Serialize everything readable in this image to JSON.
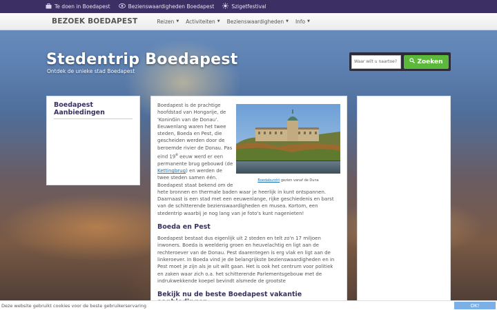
{
  "topbar": {
    "links": [
      {
        "label": "Te doen in Boedapest",
        "icon": "briefcase-icon"
      },
      {
        "label": "Bezienswaardigheden Boedapest",
        "icon": "eye-icon"
      },
      {
        "label": "Szigetfestival",
        "icon": "sun-icon"
      }
    ]
  },
  "navbar": {
    "brand": "BEZOEK BOEDAPEST",
    "menu": [
      "Reizen",
      "Activiteiten",
      "Bezienswaardigheden",
      "Info"
    ]
  },
  "hero": {
    "title": "Stedentrip Boedapest",
    "subtitle": "Ontdek de unieke stad Boedapest"
  },
  "search": {
    "placeholder": "Waar wilt u naartoe?",
    "button_label": "Zoeken"
  },
  "sidebar": {
    "heading": "Boedapest Aanbiedingen"
  },
  "article": {
    "image_caption_link": "Boedaburcht",
    "image_caption_rest": " gezien vanaf de Duna",
    "intro_1": "Boedapest is de prachtige hoofdstad van Hongarije, de 'KoninGin van de Donau'. Eeuwenlang waren het twee steden, Boeda en Pest, die gescheiden werden door de beroemde rivier de Donau. Pas eind 19",
    "intro_sup": "e",
    "intro_2": " eeuw werd er een permanente brug gebouwd (de ",
    "intro_link": "Kettingbrug",
    "intro_3": ") en werden de twee steden samen één. Boedapest staat bekend om de hete bronnen en thermale baden waar je heerlijk in kunt ontspannen. Daarnaast is een stad met een eeuwenlange, rijke geschiedenis en barst van de schitterende bezienswaardigheden en musea. Kortom, een stedentrip waarbij je nog lang van je foto's kunt nagenieten!",
    "heading_2": "Boeda en Pest",
    "para_2": "Boedapest bestaat dus eigenlijk uit 2 steden en telt zo'n 17 miljoen inwoners. Boeda is weelderig groen en heuvelachtig en ligt  aan de rechteroever van de Donau. Pest daarentegen is erg vlak en ligt aan de linkeroever. In Boeda vind je de belangrijkste bezienswaardigheden en in Pest moet je zijn als je uit wilt gaan. Het is ook het centrum voor politiek en zaken waar zich o.a. het schitterende Parlementsgebouw met de indrukwekkende koepel bevindt alsmede de grootste",
    "heading_3": "Bekijk nu de beste Boedapest vakantie aanbiedingen"
  },
  "cookie": {
    "text": "Deze website gebruikt cookies voor de beste gebruikerservaring",
    "button_label": "OK!"
  },
  "colors": {
    "topbar": "#3b2f63",
    "accent_green": "#5cb83a",
    "heading_purple": "#3b2f63",
    "link_blue": "#1a6dae",
    "cookie_button": "#7bb0e6"
  }
}
